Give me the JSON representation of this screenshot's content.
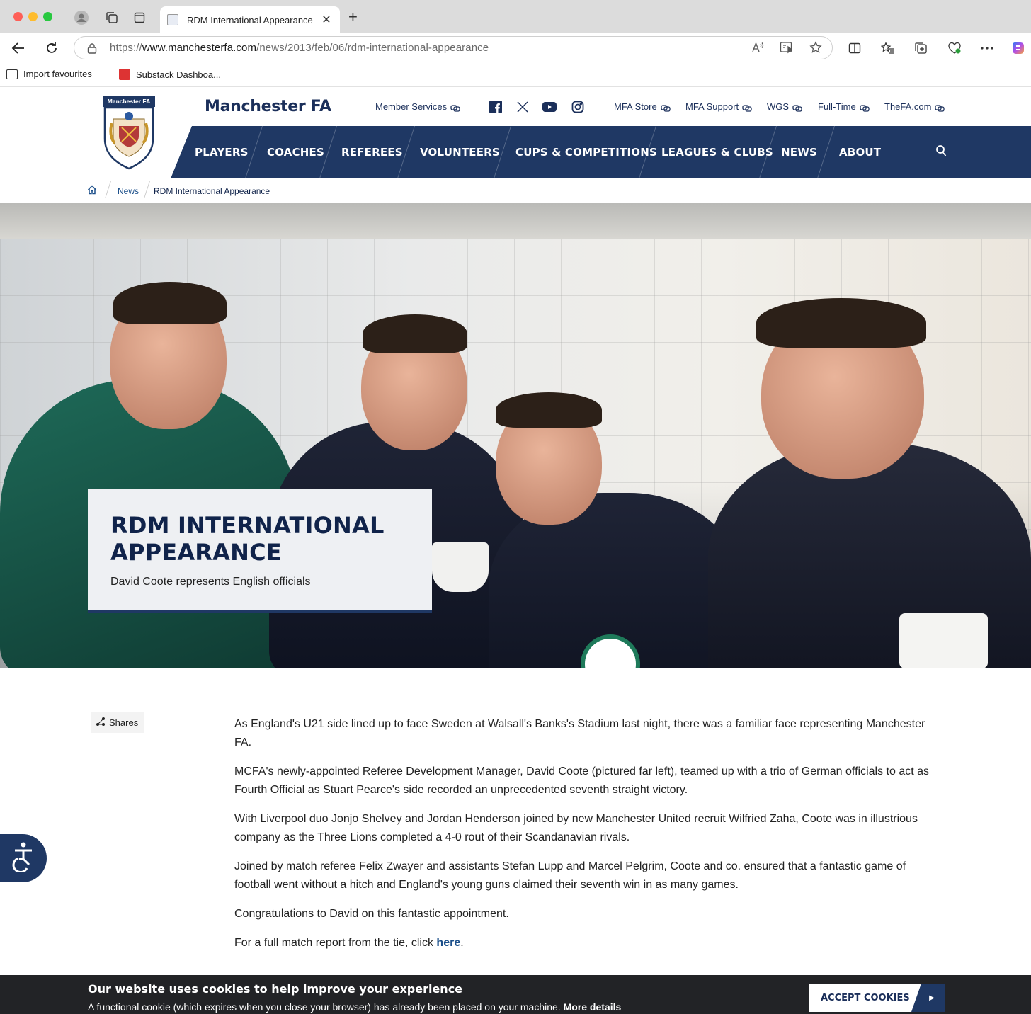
{
  "browser": {
    "tab_title": "RDM International Appearance",
    "url_prefix": "https://",
    "url_host": "www.manchesterfa.com",
    "url_path": "/news/2013/feb/06/rdm-international-appearance",
    "favourites": [
      {
        "label": "Import favourites"
      },
      {
        "label": "Substack Dashboa..."
      }
    ]
  },
  "site": {
    "brand": "Manchester FA",
    "crest_text": "Manchester FA",
    "utility_links": [
      {
        "label": "Member Services"
      },
      {
        "label": "MFA Store"
      },
      {
        "label": "MFA Support"
      },
      {
        "label": "WGS"
      },
      {
        "label": "Full-Time"
      },
      {
        "label": "TheFA.com"
      }
    ],
    "social": [
      "facebook-icon",
      "x-icon",
      "youtube-icon",
      "instagram-icon"
    ],
    "nav": [
      {
        "label": "PLAYERS"
      },
      {
        "label": "COACHES"
      },
      {
        "label": "REFEREES"
      },
      {
        "label": "VOLUNTEERS"
      },
      {
        "label": "CUPS & COMPETITIONS"
      },
      {
        "label": "LEAGUES & CLUBS"
      },
      {
        "label": "NEWS"
      },
      {
        "label": "ABOUT"
      }
    ],
    "breadcrumb": [
      {
        "label": "News"
      },
      {
        "label": "RDM International Appearance"
      }
    ],
    "colors": {
      "navy": "#1f3864",
      "text_navy": "#1b2f5a"
    }
  },
  "hero": {
    "title": "RDM INTERNATIONAL APPEARANCE",
    "subtitle": "David Coote represents English officials"
  },
  "article": {
    "shares_label": "Shares",
    "paragraphs": [
      "As England's U21 side lined up to face Sweden at Walsall's Banks's Stadium last night, there was a familiar face representing Manchester FA.",
      "MCFA's newly-appointed Referee Development Manager, David Coote (pictured far left), teamed up with a trio of German officials to act as Fourth Official as Stuart Pearce's side recorded an unprecedented seventh straight victory.",
      "With Liverpool duo Jonjo Shelvey and Jordan Henderson joined by new Manchester United recruit Wilfried Zaha, Coote was in illustrious company as the Three Lions completed a 4-0 rout of their Scandanavian rivals.",
      "Joined by match referee Felix Zwayer and assistants Stefan Lupp and Marcel Pelgrim, Coote and co. ensured that a fantastic game of football went without a hitch and England's young guns claimed their seventh win in as many games.",
      "Congratulations to David on this fantastic appointment."
    ],
    "last_paragraph_prefix": "For a full match report from the tie, click ",
    "last_paragraph_link": "here",
    "last_paragraph_suffix": "."
  },
  "cookie": {
    "heading": "Our website uses cookies to help improve your experience",
    "text": "A functional cookie (which expires when you close your browser) has already been placed on your machine. ",
    "more": "More details",
    "accept": "ACCEPT COOKIES"
  }
}
